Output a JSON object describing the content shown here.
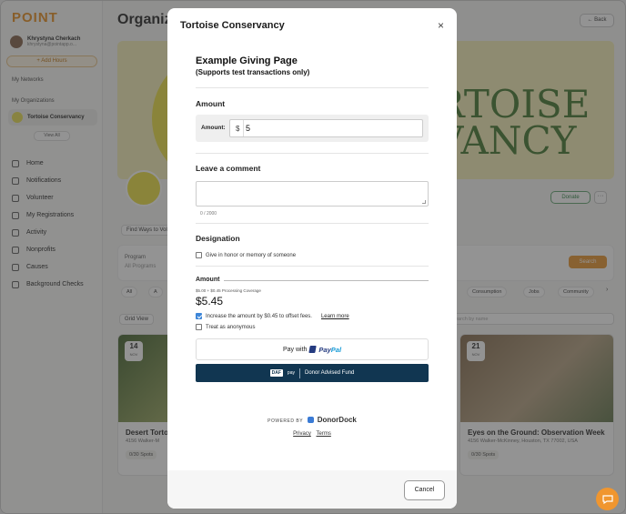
{
  "app": {
    "logo": "POINT",
    "user_name": "Khrystyna Cherkach",
    "user_email": "khrystyna@pointapp.o...",
    "add_button": "+ Add Hours",
    "my_networks": "My Networks",
    "my_organizations": "My Organizations",
    "org_name": "Tortoise Conservancy",
    "view_all": "View All",
    "nav": [
      "Home",
      "Notifications",
      "Volunteer",
      "My Registrations",
      "Activity",
      "Nonprofits",
      "Causes",
      "Background Checks"
    ],
    "page_title": "Organiza",
    "back": "← Back",
    "banner_text_line1": "RTOISE",
    "banner_text_line2": "VANCY",
    "donate": "Donate",
    "more": "···",
    "find_ways": "Find Ways to Volu",
    "program_label": "Program",
    "program_value": "All Programs",
    "search_btn": "Search",
    "chip_all": "All",
    "chip_a": "A",
    "chip_consumption": "Consumption",
    "chip_jobs": "Jobs",
    "chip_community": "Community",
    "grid_view": "Grid View",
    "search_placeholder": "earch by name",
    "card_left": {
      "day": "14",
      "month": "NOV",
      "title": "Desert Torto",
      "addr": "4156 Walker-M",
      "spots": "0/30 Spots"
    },
    "card_right": {
      "day": "21",
      "month": "NOV",
      "title": "Eyes on the Ground: Observation Week",
      "addr": "4156 Walker-McKinney, Houston, TX 77002, USA",
      "spots": "0/30 Spots"
    }
  },
  "modal": {
    "title": "Tortoise Conservancy",
    "close": "×",
    "heading": "Example Giving Page",
    "subheading": "(Supports test transactions only)",
    "amount_section": "Amount",
    "amount_label": "Amount:",
    "currency": "$",
    "amount_value": "5",
    "comment_section": "Leave a comment",
    "char_count": "0 / 2000",
    "designation_section": "Designation",
    "honor_label": "Give in honor or memory of someone",
    "amount_summary_head": "Amount",
    "amount_detail": "$5.00 + $0.45 Processing Coverage",
    "amount_total": "$5.45",
    "increase_label": "Increase the amount by $0.45 to offset fees.",
    "learn_more": "Learn more",
    "anonymous_label": "Treat as anonymous",
    "pay_with": "Pay with",
    "paypal_pay": "Pay",
    "paypal_pal": "Pal",
    "daf_logo": "DAF",
    "daf_pay": "pay",
    "daf_label": "Donor Advised Fund",
    "powered_by": "POWERED BY",
    "powered_brand": "DonorDock",
    "privacy": "Privacy",
    "terms": "Terms",
    "cancel": "Cancel"
  },
  "colors": {
    "accent": "#e8942c",
    "daf_bg": "#113651",
    "checkbox_checked": "#3d86d8",
    "banner_bg": "#f4eebb",
    "banner_text": "#4e7f3b"
  }
}
